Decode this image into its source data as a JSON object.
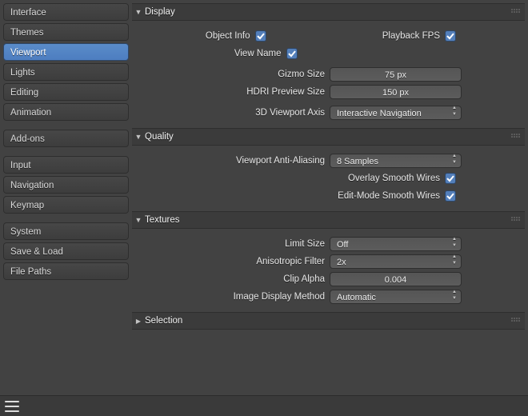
{
  "sidebar": {
    "groups": [
      [
        "Interface",
        "Themes",
        "Viewport",
        "Lights",
        "Editing",
        "Animation"
      ],
      [
        "Add-ons"
      ],
      [
        "Input",
        "Navigation",
        "Keymap"
      ],
      [
        "System",
        "Save & Load",
        "File Paths"
      ]
    ],
    "active": "Viewport"
  },
  "panels": {
    "display": {
      "title": "Display",
      "collapsed": false,
      "object_info": {
        "label": "Object Info",
        "checked": true
      },
      "playback_fps": {
        "label": "Playback FPS",
        "checked": true
      },
      "view_name": {
        "label": "View Name",
        "checked": true
      },
      "gizmo_size": {
        "label": "Gizmo Size",
        "value": "75 px"
      },
      "hdri_preview": {
        "label": "HDRI Preview Size",
        "value": "150 px"
      },
      "viewport_axis": {
        "label": "3D Viewport Axis",
        "value": "Interactive Navigation"
      }
    },
    "quality": {
      "title": "Quality",
      "collapsed": false,
      "viewport_aa": {
        "label": "Viewport Anti-Aliasing",
        "value": "8 Samples"
      },
      "overlay_smooth": {
        "label": "Overlay Smooth Wires",
        "checked": true
      },
      "editmode_smooth": {
        "label": "Edit-Mode Smooth Wires",
        "checked": true
      }
    },
    "textures": {
      "title": "Textures",
      "collapsed": false,
      "limit_size": {
        "label": "Limit Size",
        "value": "Off"
      },
      "aniso": {
        "label": "Anisotropic Filter",
        "value": "2x"
      },
      "clip_alpha": {
        "label": "Clip Alpha",
        "value": "0.004"
      },
      "image_disp": {
        "label": "Image Display Method",
        "value": "Automatic"
      }
    },
    "selection": {
      "title": "Selection",
      "collapsed": true
    }
  }
}
